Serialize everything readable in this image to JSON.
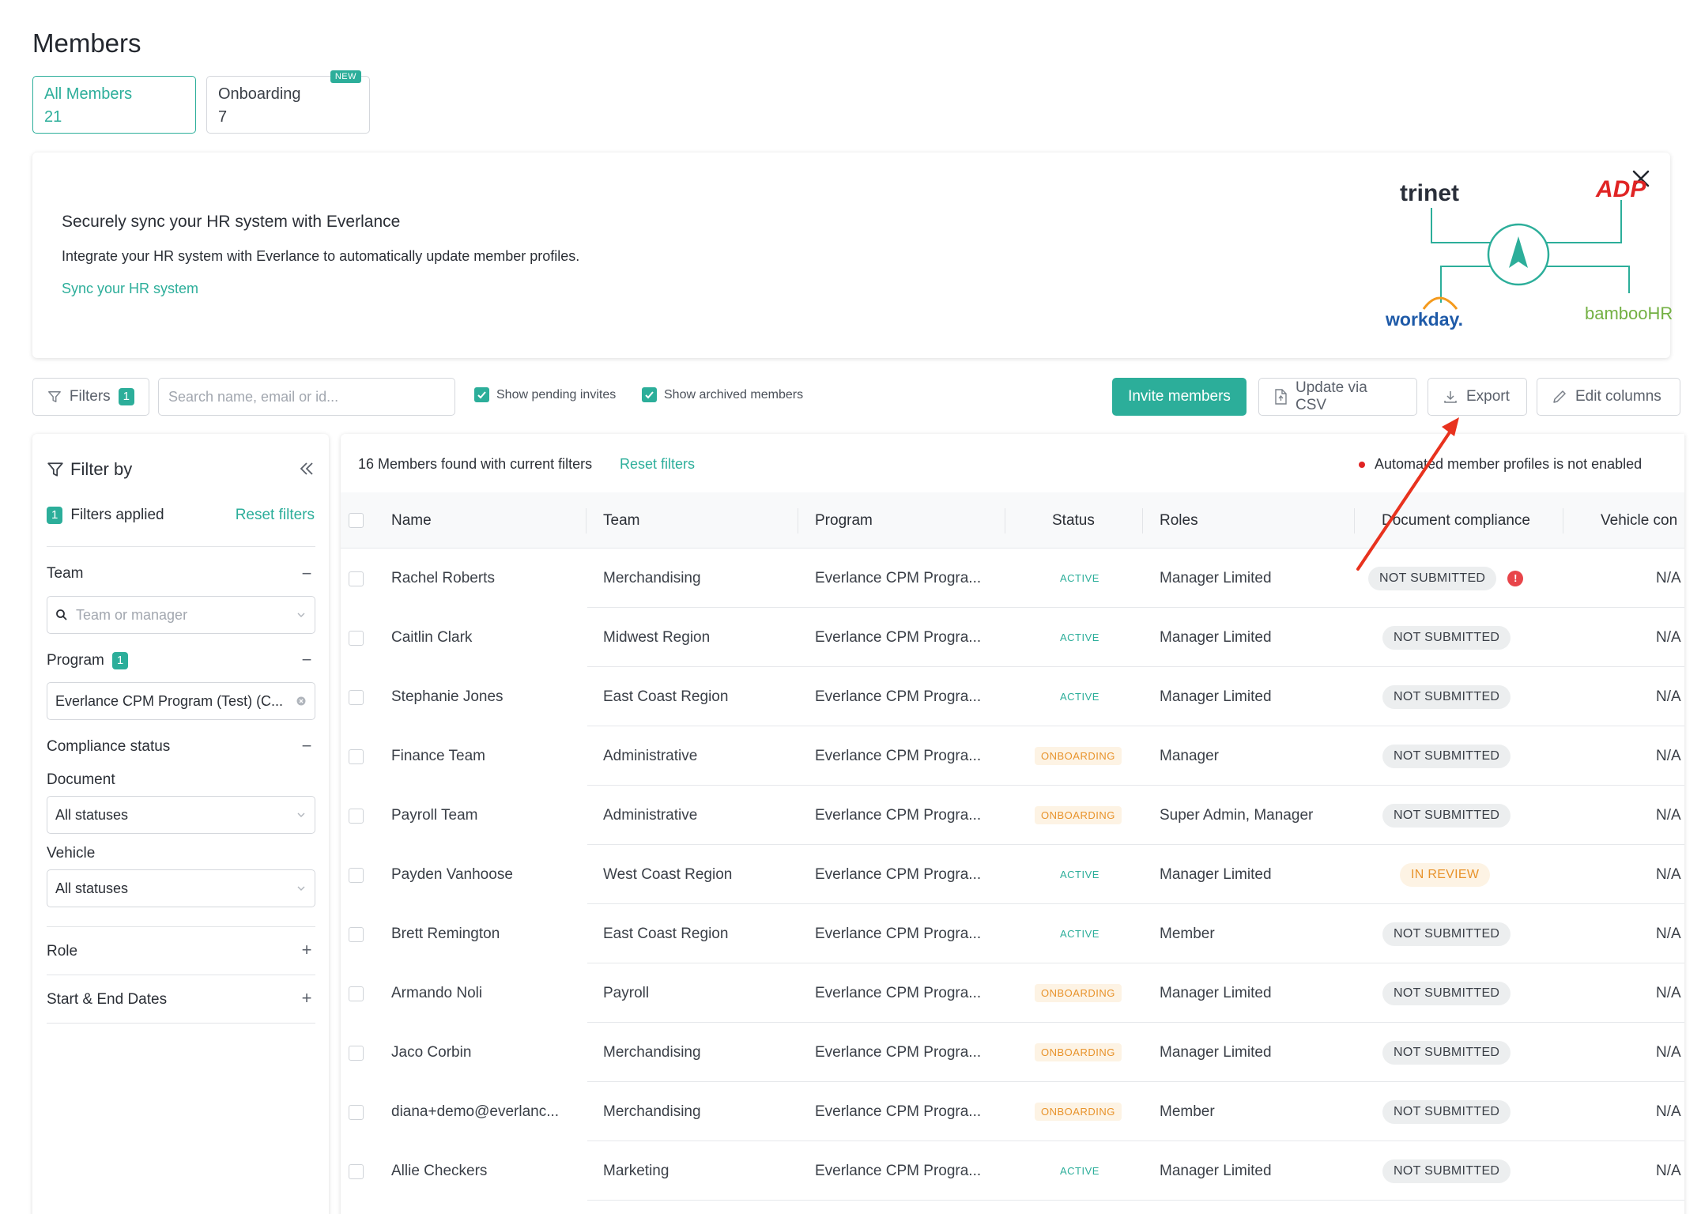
{
  "page": {
    "title": "Members"
  },
  "tabs": [
    {
      "label": "All Members",
      "count": "21"
    },
    {
      "label": "Onboarding",
      "count": "7",
      "badge": "NEW"
    }
  ],
  "banner": {
    "title": "Securely sync your HR system with Everlance",
    "description": "Integrate your HR system with Everlance to automatically update member profiles.",
    "link": "Sync your HR system",
    "logos": {
      "trinet": "trinet",
      "adp": "ADP",
      "workday": "workday.",
      "bamboo": "bambooHR"
    }
  },
  "toolbar": {
    "filters_label": "Filters",
    "filters_count": "1",
    "search_placeholder": "Search name, email or id...",
    "show_pending": "Show pending invites",
    "show_archived": "Show archived members",
    "invite": "Invite members",
    "update_csv": "Update via CSV",
    "export": "Export",
    "edit_columns": "Edit columns"
  },
  "sidebar": {
    "title": "Filter by",
    "applied_count": "1",
    "applied_label": "Filters applied",
    "reset": "Reset filters",
    "team_label": "Team",
    "team_placeholder": "Team or manager",
    "program_label": "Program",
    "program_count": "1",
    "program_value": "Everlance CPM Program (Test) (C...",
    "compliance_label": "Compliance status",
    "document_label": "Document",
    "document_value": "All statuses",
    "vehicle_label": "Vehicle",
    "vehicle_value": "All statuses",
    "role_label": "Role",
    "dates_label": "Start & End Dates",
    "minus": "−",
    "plus": "+"
  },
  "table": {
    "found": "16 Members found with current filters",
    "reset": "Reset filters",
    "notice": "Automated member profiles is not enabled",
    "headers": {
      "name": "Name",
      "team": "Team",
      "program": "Program",
      "status": "Status",
      "roles": "Roles",
      "document": "Document compliance",
      "vehicle": "Vehicle con"
    },
    "rows": [
      {
        "name": "Rachel Roberts",
        "team": "Merchandising",
        "program": "Everlance CPM Progra...",
        "status": "ACTIVE",
        "role": "Manager Limited",
        "doc": "NOT SUBMITTED",
        "vehicle": "N/A"
      },
      {
        "name": "Caitlin Clark",
        "team": "Midwest Region",
        "program": "Everlance CPM Progra...",
        "status": "ACTIVE",
        "role": "Manager Limited",
        "doc": "NOT SUBMITTED",
        "vehicle": "N/A"
      },
      {
        "name": "Stephanie Jones",
        "team": "East Coast Region",
        "program": "Everlance CPM Progra...",
        "status": "ACTIVE",
        "role": "Manager Limited",
        "doc": "NOT SUBMITTED",
        "vehicle": "N/A"
      },
      {
        "name": "Finance Team",
        "team": "Administrative",
        "program": "Everlance CPM Progra...",
        "status": "ONBOARDING",
        "role": "Manager",
        "doc": "NOT SUBMITTED",
        "vehicle": "N/A"
      },
      {
        "name": "Payroll Team",
        "team": "Administrative",
        "program": "Everlance CPM Progra...",
        "status": "ONBOARDING",
        "role": "Super Admin, Manager",
        "doc": "NOT SUBMITTED",
        "vehicle": "N/A"
      },
      {
        "name": "Payden Vanhoose",
        "team": "West Coast Region",
        "program": "Everlance CPM Progra...",
        "status": "ACTIVE",
        "role": "Manager Limited",
        "doc": "IN REVIEW",
        "vehicle": "N/A"
      },
      {
        "name": "Brett Remington",
        "team": "East Coast Region",
        "program": "Everlance CPM Progra...",
        "status": "ACTIVE",
        "role": "Member",
        "doc": "NOT SUBMITTED",
        "vehicle": "N/A"
      },
      {
        "name": "Armando Noli",
        "team": "Payroll",
        "program": "Everlance CPM Progra...",
        "status": "ONBOARDING",
        "role": "Manager Limited",
        "doc": "NOT SUBMITTED",
        "vehicle": "N/A"
      },
      {
        "name": "Jaco Corbin",
        "team": "Merchandising",
        "program": "Everlance CPM Progra...",
        "status": "ONBOARDING",
        "role": "Manager Limited",
        "doc": "NOT SUBMITTED",
        "vehicle": "N/A"
      },
      {
        "name": "diana+demo@everlanc...",
        "team": "Merchandising",
        "program": "Everlance CPM Progra...",
        "status": "ONBOARDING",
        "role": "Member",
        "doc": "NOT SUBMITTED",
        "vehicle": "N/A"
      },
      {
        "name": "Allie Checkers",
        "team": "Marketing",
        "program": "Everlance CPM Progra...",
        "status": "ACTIVE",
        "role": "Manager Limited",
        "doc": "NOT SUBMITTED",
        "vehicle": "N/A"
      }
    ]
  },
  "colors": {
    "accent": "#2cae9a",
    "warning": "#e8932b",
    "alert": "#e8454a",
    "annotation": "#e8321e"
  }
}
